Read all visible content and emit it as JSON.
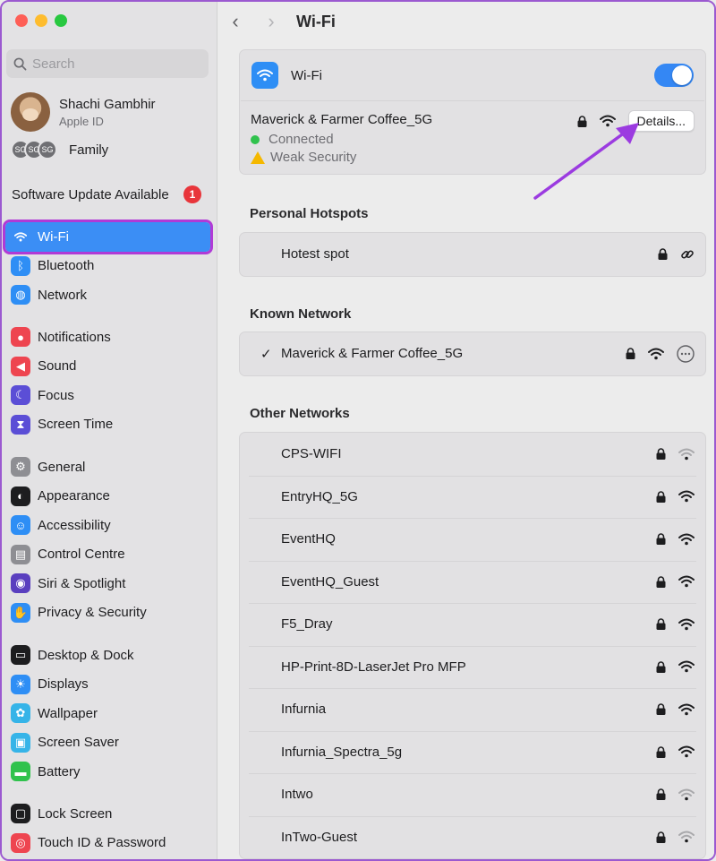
{
  "window": {
    "traffic_lights": [
      "close",
      "minimize",
      "zoom"
    ]
  },
  "sidebar": {
    "search_placeholder": "Search",
    "profile": {
      "name": "Shachi Gambhir",
      "sub": "Apple ID"
    },
    "family": {
      "avatars": [
        "SG",
        "SG",
        "SG"
      ],
      "label": "Family"
    },
    "update": {
      "label": "Software Update Available",
      "count": "1"
    },
    "group1": [
      {
        "label": "Wi-Fi",
        "icon": "wifi-icon",
        "color": "#2e8ef5",
        "selected": true
      },
      {
        "label": "Bluetooth",
        "icon": "bluetooth-icon",
        "color": "#2e8ef5"
      },
      {
        "label": "Network",
        "icon": "globe-icon",
        "color": "#2e8ef5"
      }
    ],
    "group2": [
      {
        "label": "Notifications",
        "icon": "bell-icon",
        "color": "#ee4550"
      },
      {
        "label": "Sound",
        "icon": "speaker-icon",
        "color": "#ee4550"
      },
      {
        "label": "Focus",
        "icon": "moon-icon",
        "color": "#5b4ed6"
      },
      {
        "label": "Screen Time",
        "icon": "hourglass-icon",
        "color": "#5b4ed6"
      }
    ],
    "group3": [
      {
        "label": "General",
        "icon": "gear-icon",
        "color": "#8e8e93"
      },
      {
        "label": "Appearance",
        "icon": "appearance-icon",
        "color": "#1d1d1f"
      },
      {
        "label": "Accessibility",
        "icon": "accessibility-icon",
        "color": "#2e8ef5"
      },
      {
        "label": "Control Centre",
        "icon": "control-centre-icon",
        "color": "#8e8e93"
      },
      {
        "label": "Siri & Spotlight",
        "icon": "siri-icon",
        "color": "#5a3fbf"
      },
      {
        "label": "Privacy & Security",
        "icon": "hand-icon",
        "color": "#2e8ef5"
      }
    ],
    "group4": [
      {
        "label": "Desktop & Dock",
        "icon": "dock-icon",
        "color": "#1d1d1f"
      },
      {
        "label": "Displays",
        "icon": "sun-icon",
        "color": "#2e8ef5"
      },
      {
        "label": "Wallpaper",
        "icon": "flower-icon",
        "color": "#36b4e8"
      },
      {
        "label": "Screen Saver",
        "icon": "screensaver-icon",
        "color": "#36b4e8"
      },
      {
        "label": "Battery",
        "icon": "battery-icon",
        "color": "#30c24d"
      }
    ],
    "group5": [
      {
        "label": "Lock Screen",
        "icon": "lock-screen-icon",
        "color": "#1d1d1f"
      },
      {
        "label": "Touch ID & Password",
        "icon": "fingerprint-icon",
        "color": "#ee4550"
      }
    ]
  },
  "toolbar": {
    "title": "Wi-Fi",
    "back": "‹",
    "forward": "›"
  },
  "wifi_card": {
    "label": "Wi-Fi",
    "enabled": true,
    "connected": {
      "name": "Maverick & Farmer Coffee_5G",
      "status": "Connected",
      "warning": "Weak Security",
      "details_label": "Details..."
    }
  },
  "hotspots": {
    "title": "Personal Hotspots",
    "items": [
      {
        "name": "Hotest spot"
      }
    ]
  },
  "known": {
    "title": "Known Network",
    "items": [
      {
        "name": "Maverick & Farmer Coffee_5G",
        "check": "✓"
      }
    ]
  },
  "other": {
    "title": "Other Networks",
    "items": [
      {
        "name": "CPS-WIFI",
        "strength": "weak"
      },
      {
        "name": "EntryHQ_5G",
        "strength": "strong"
      },
      {
        "name": "EventHQ",
        "strength": "strong"
      },
      {
        "name": "EventHQ_Guest",
        "strength": "strong"
      },
      {
        "name": "F5_Dray",
        "strength": "strong"
      },
      {
        "name": "HP-Print-8D-LaserJet Pro MFP",
        "strength": "strong"
      },
      {
        "name": "Infurnia",
        "strength": "strong"
      },
      {
        "name": "Infurnia_Spectra_5g",
        "strength": "strong"
      },
      {
        "name": "Intwo",
        "strength": "weak"
      },
      {
        "name": "InTwo-Guest",
        "strength": "weak"
      }
    ]
  },
  "colors": {
    "accent": "#3b8ef5",
    "highlight_frame": "#b03ad6",
    "arrow": "#9b3be0"
  }
}
